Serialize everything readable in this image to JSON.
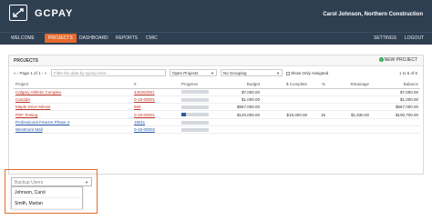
{
  "app": {
    "brand": "GCPAY",
    "user": "Carol Johnson, Northern Construction"
  },
  "nav": {
    "items": [
      "WELCOME",
      "PROJECTS",
      "DASHBOARD",
      "REPORTS",
      "CMIC"
    ],
    "right": [
      "SETTINGS",
      "LOGOUT"
    ],
    "active": "PROJECTS"
  },
  "panel": {
    "title": "PROJECTS",
    "new_project": "NEW PROJECT"
  },
  "toolbar": {
    "pager": "Page 1 of 1",
    "search_placeholder": "Filter the data by typing here...",
    "status_filter": "Open Projects",
    "grouping": "No Grouping",
    "only_assigned": "Show Only Assigned",
    "range": "1 to 6 of 6"
  },
  "table": {
    "headers": [
      "Project",
      "#",
      "Progress",
      "Budget",
      "$ Complete",
      "%",
      "Retainage",
      "Balance"
    ],
    "rows": [
      {
        "project": "Calgary Athletic Complex",
        "number": "440252951",
        "progress": 0,
        "budget": "$7,000.00",
        "complete": "",
        "pct": "",
        "retainage": "",
        "balance": "$7,000.00",
        "color": "red"
      },
      {
        "project": "Canada",
        "number": "0-19-00001",
        "progress": 0,
        "budget": "$1,000.00",
        "complete": "",
        "pct": "",
        "retainage": "",
        "balance": "$1,000.00",
        "color": "red"
      },
      {
        "project": "Maple Drive Minnie",
        "number": "656",
        "progress": 0,
        "budget": "$567,000.00",
        "complete": "",
        "pct": "",
        "retainage": "",
        "balance": "$567,000.00",
        "color": "red"
      },
      {
        "project": "PDF Testing",
        "number": "0-19-00001",
        "progress": 0.16,
        "budget": "$120,000.00",
        "complete": "$19,300.00",
        "pct": "16",
        "retainage": "$1,930.00",
        "balance": "$100,700.00",
        "color": "red"
      },
      {
        "project": "Professional Freezer Phase 4",
        "number": "18011",
        "progress": 0,
        "budget": "",
        "complete": "",
        "pct": "",
        "retainage": "",
        "balance": "",
        "color": "blue"
      },
      {
        "project": "Westmont Mall",
        "number": "0-19-00002",
        "progress": 0,
        "budget": "",
        "complete": "",
        "pct": "",
        "retainage": "",
        "balance": "",
        "color": "blue"
      }
    ]
  },
  "backup_users": {
    "placeholder": "Backup Users",
    "options": [
      "Johnson, Carol",
      "Smith, Marlan"
    ]
  }
}
